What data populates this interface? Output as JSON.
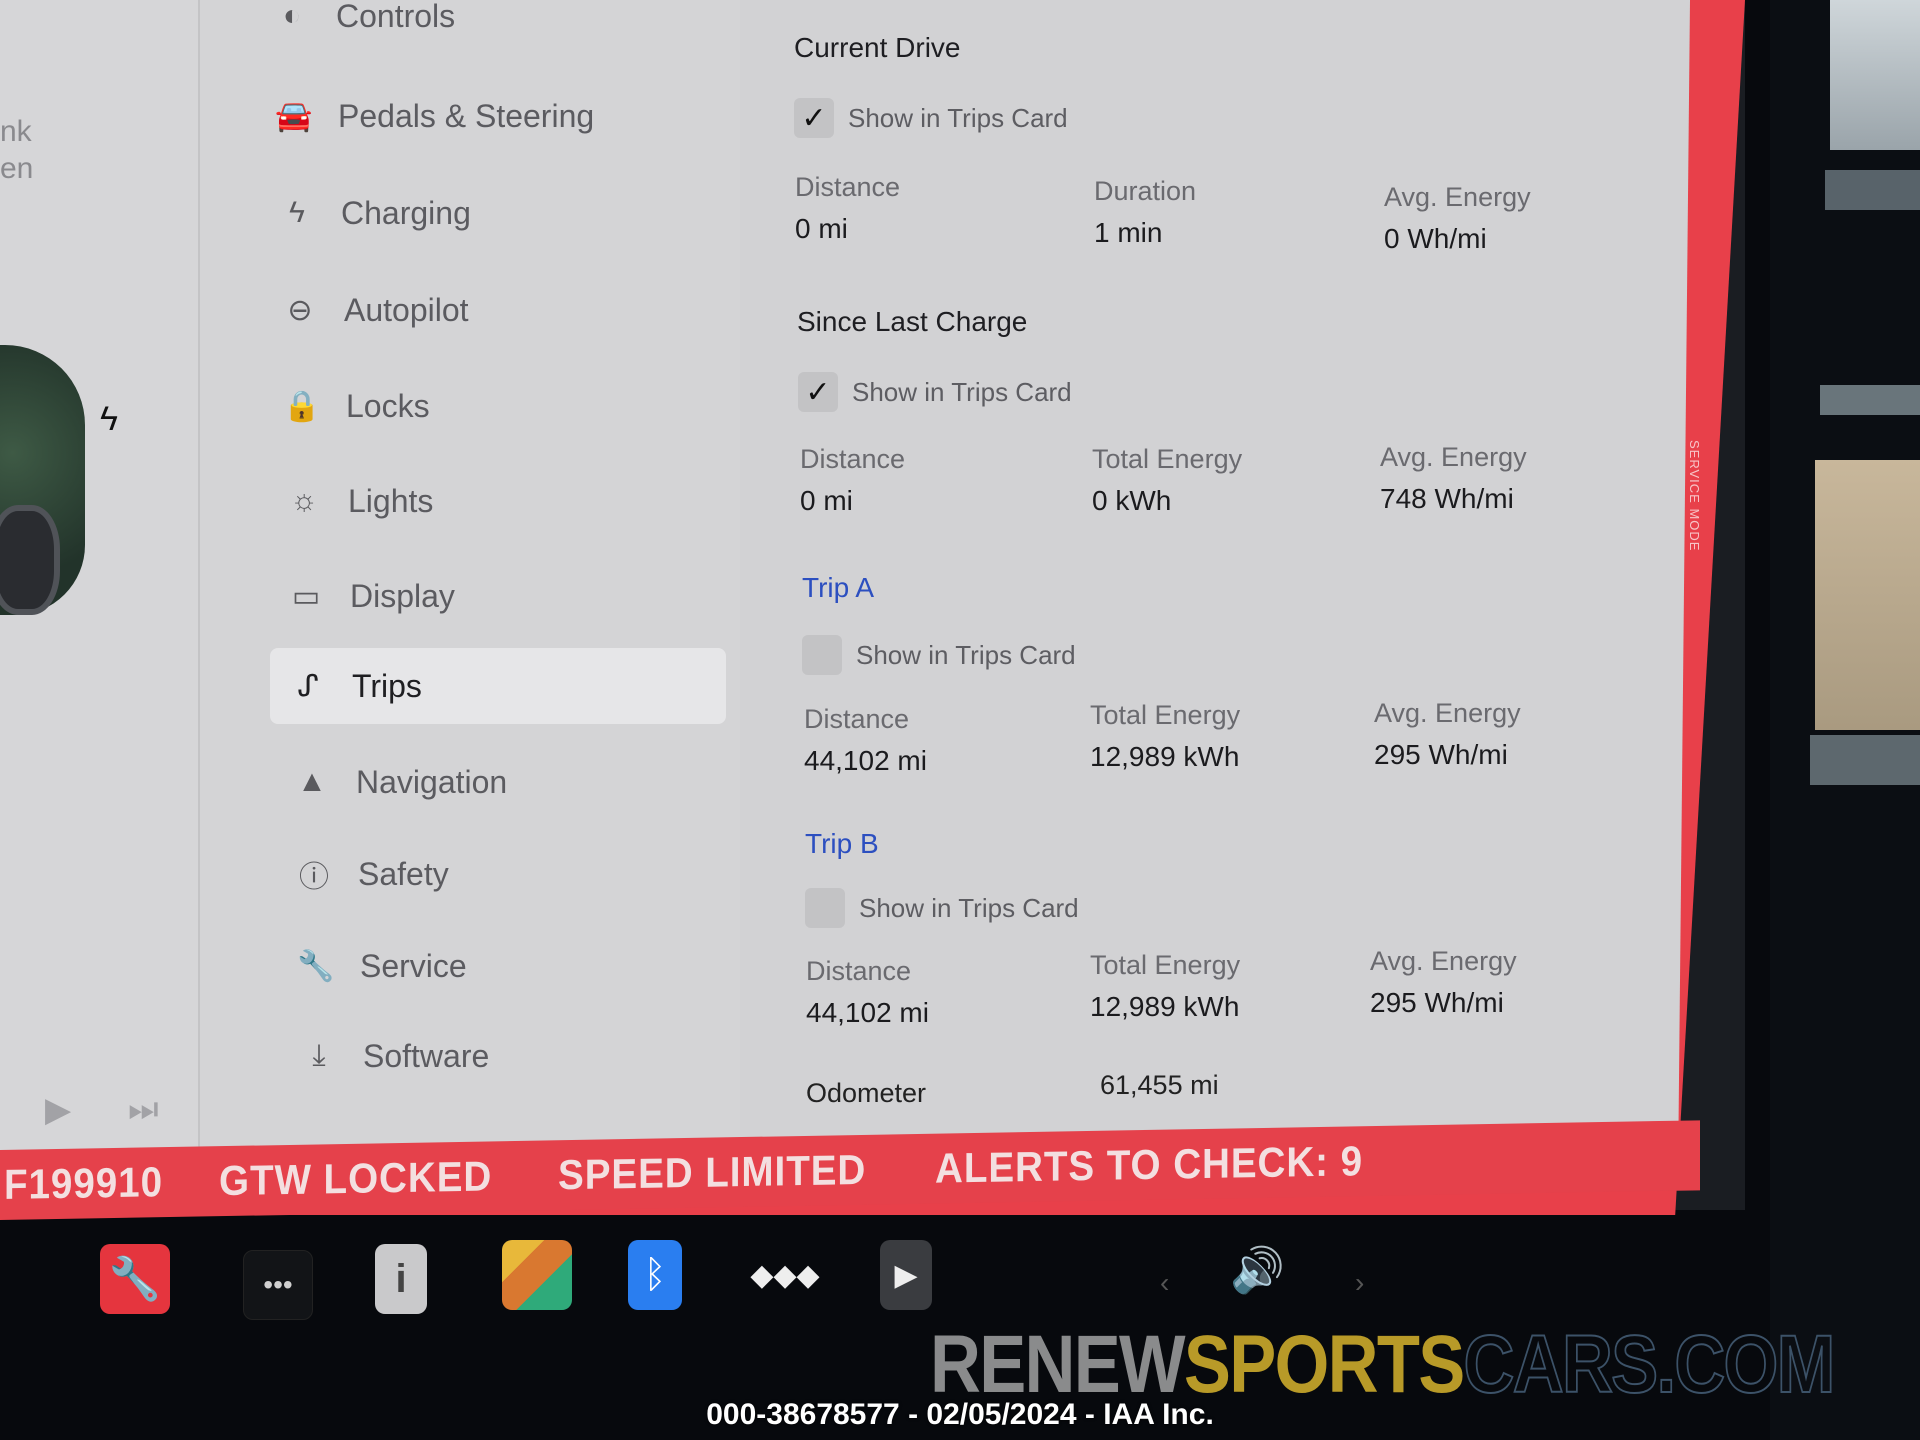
{
  "car_panel": {
    "fragments": [
      "nk",
      "en"
    ],
    "media": {
      "play_icon": "play-icon",
      "next_icon": "skip-next-icon"
    }
  },
  "sidebar": {
    "items": [
      {
        "label": "Controls",
        "icon": "toggle-icon",
        "glyph": "◐",
        "active": false
      },
      {
        "label": "Pedals & Steering",
        "icon": "car-icon",
        "glyph": "🚘",
        "active": false
      },
      {
        "label": "Charging",
        "icon": "lightning-icon",
        "glyph": "ϟ",
        "active": false
      },
      {
        "label": "Autopilot",
        "icon": "steering-wheel-icon",
        "glyph": "⊖",
        "active": false
      },
      {
        "label": "Locks",
        "icon": "lock-icon",
        "glyph": "🔒",
        "active": false
      },
      {
        "label": "Lights",
        "icon": "light-bulb-icon",
        "glyph": "☼",
        "active": false
      },
      {
        "label": "Display",
        "icon": "display-icon",
        "glyph": "▭",
        "active": false
      },
      {
        "label": "Trips",
        "icon": "trips-route-icon",
        "glyph": "ᔑ",
        "active": true
      },
      {
        "label": "Navigation",
        "icon": "navigation-arrow-icon",
        "glyph": "▲",
        "active": false
      },
      {
        "label": "Safety",
        "icon": "alert-circle-icon",
        "glyph": "ⓘ",
        "active": false
      },
      {
        "label": "Service",
        "icon": "wrench-icon",
        "glyph": "🔧",
        "active": false
      },
      {
        "label": "Software",
        "icon": "download-icon",
        "glyph": "⤓",
        "active": false
      }
    ]
  },
  "content": {
    "current_drive": {
      "title": "Current Drive",
      "show_in_trips_card": {
        "label": "Show in Trips Card",
        "checked": true
      },
      "stats": [
        {
          "label": "Distance",
          "value": "0 mi"
        },
        {
          "label": "Duration",
          "value": "1 min"
        },
        {
          "label": "Avg. Energy",
          "value": "0 Wh/mi"
        }
      ]
    },
    "since_last_charge": {
      "title": "Since Last Charge",
      "show_in_trips_card": {
        "label": "Show in Trips Card",
        "checked": true
      },
      "stats": [
        {
          "label": "Distance",
          "value": "0 mi"
        },
        {
          "label": "Total Energy",
          "value": "0 kWh"
        },
        {
          "label": "Avg. Energy",
          "value": "748 Wh/mi"
        }
      ]
    },
    "trip_a": {
      "title": "Trip A",
      "show_in_trips_card": {
        "label": "Show in Trips Card",
        "checked": false
      },
      "stats": [
        {
          "label": "Distance",
          "value": "44,102 mi"
        },
        {
          "label": "Total Energy",
          "value": "12,989 kWh"
        },
        {
          "label": "Avg. Energy",
          "value": "295 Wh/mi"
        }
      ]
    },
    "trip_b": {
      "title": "Trip B",
      "show_in_trips_card": {
        "label": "Show in Trips Card",
        "checked": false
      },
      "stats": [
        {
          "label": "Distance",
          "value": "44,102 mi"
        },
        {
          "label": "Total Energy",
          "value": "12,989 kWh"
        },
        {
          "label": "Avg. Energy",
          "value": "295 Wh/mi"
        }
      ]
    },
    "odometer": {
      "label": "Odometer",
      "value": "61,455 mi"
    }
  },
  "service_mode_label": "SERVICE MODE",
  "alert_bar": {
    "items": [
      "F199910",
      "GTW LOCKED",
      "SPEED LIMITED",
      "ALERTS TO CHECK: 9"
    ]
  },
  "dock": {
    "icons": {
      "service": "🔧",
      "more": "•••",
      "manual": "i",
      "bluetooth": "ᛒ",
      "tidal": "◆◆◆",
      "theater": "▶",
      "volume": "🔊",
      "vol_prev": "‹",
      "vol_next": "›"
    }
  },
  "watermark": {
    "part1": "RENEW",
    "part2": "SPORTS",
    "part3": "CARS.COM"
  },
  "caption": "000-38678577 - 02/05/2024 - IAA Inc.",
  "colors": {
    "alert_red": "#e5414b",
    "link_blue": "#2c4fc0",
    "ui_background": "#d2d2d4"
  }
}
